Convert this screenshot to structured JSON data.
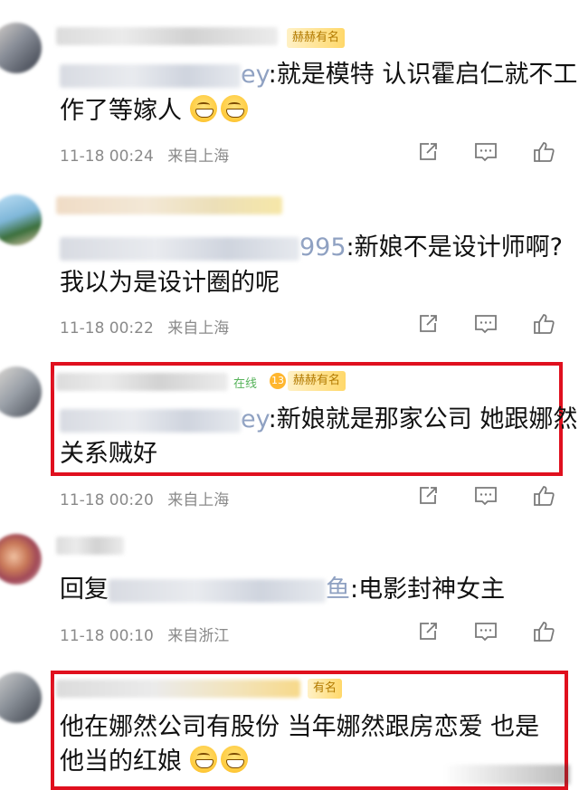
{
  "comments": [
    {
      "tag": "赫赫有名",
      "handle_tail": "ey",
      "text_after_handle": ":就是模特 认识霍启仁就不工",
      "text_line2": "作了等嫁人",
      "emoji_count": 2,
      "time": "11-18 00:24",
      "location": "来自上海"
    },
    {
      "handle_tail": "995",
      "text_after_handle": ":新娘不是设计师啊?",
      "text_line2": "我以为是设计圈的呢",
      "time": "11-18 00:22",
      "location": "来自上海"
    },
    {
      "online_label": "在线",
      "level": "13",
      "tag": "赫赫有名",
      "handle_tail": "ey",
      "text_after_handle": ":新娘就是那家公司 她跟娜然",
      "text_line2": "关系贼好",
      "time": "11-18 00:20",
      "location": "来自上海"
    },
    {
      "reply_prefix": "回复",
      "handle_tail": "鱼",
      "text_after_handle": ":电影封神女主",
      "time": "11-18 00:10",
      "location": "来自浙江"
    },
    {
      "tag": "有名",
      "text_line1": "他在娜然公司有股份 当年娜然跟房恋爱 也是",
      "text_line2": "他当的红娘",
      "emoji_count": 2
    }
  ],
  "icons": {
    "share": "share-icon",
    "comment": "comment-icon",
    "like": "thumbs-up-icon"
  },
  "colors": {
    "highlight": "#e0101e",
    "tag_text": "#b27a00",
    "meta_text": "#8a8a8a",
    "handle_tail": "#8fa1c2"
  }
}
